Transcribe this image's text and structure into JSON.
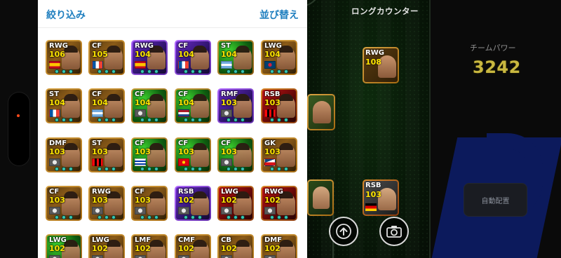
{
  "sheet": {
    "filter_label": "絞り込み",
    "sort_label": "並び替え"
  },
  "formation": {
    "title": "ロングカウンター",
    "on_pitch": [
      {
        "position": "RWG",
        "rating": "108"
      },
      {
        "position": "RSB",
        "rating": "103"
      }
    ]
  },
  "panel": {
    "team_power_label": "チームパワー",
    "team_power_value": "3242",
    "auto_button_label": "自動配置"
  },
  "icons": {
    "upload": "upload-arrow-icon",
    "camera": "camera-icon"
  },
  "cards": [
    {
      "position": "RWG",
      "rating": "106",
      "tier": "gold",
      "flag": "spain"
    },
    {
      "position": "CF",
      "rating": "105",
      "tier": "gold",
      "flag": "france"
    },
    {
      "position": "RWG",
      "rating": "104",
      "tier": "purple",
      "flag": "spain"
    },
    {
      "position": "CF",
      "rating": "104",
      "tier": "purple",
      "flag": "france"
    },
    {
      "position": "ST",
      "rating": "104",
      "tier": "green",
      "flag": "argentina"
    },
    {
      "position": "LWG",
      "rating": "104",
      "tier": "gold",
      "flag": "psg"
    },
    {
      "position": "ST",
      "rating": "104",
      "tier": "gold",
      "flag": "france"
    },
    {
      "position": "CF",
      "rating": "104",
      "tier": "gold",
      "flag": "argentina"
    },
    {
      "position": "CF",
      "rating": "104",
      "tier": "green",
      "flag": "club"
    },
    {
      "position": "CF",
      "rating": "104",
      "tier": "green",
      "flag": "netherlands"
    },
    {
      "position": "RMF",
      "rating": "103",
      "tier": "purple",
      "flag": "club"
    },
    {
      "position": "RSB",
      "rating": "103",
      "tier": "red",
      "flag": "acmilan"
    },
    {
      "position": "DMF",
      "rating": "103",
      "tier": "gold",
      "flag": "club"
    },
    {
      "position": "ST",
      "rating": "103",
      "tier": "gold",
      "flag": "acmilan"
    },
    {
      "position": "CF",
      "rating": "103",
      "tier": "green",
      "flag": "uruguay"
    },
    {
      "position": "CF",
      "rating": "103",
      "tier": "green",
      "flag": "manutd"
    },
    {
      "position": "CF",
      "rating": "103",
      "tier": "green",
      "flag": "club"
    },
    {
      "position": "GK",
      "rating": "103",
      "tier": "gold",
      "flag": "czech"
    },
    {
      "position": "CF",
      "rating": "103",
      "tier": "gold",
      "flag": "club"
    },
    {
      "position": "RWG",
      "rating": "103",
      "tier": "gold",
      "flag": "club"
    },
    {
      "position": "CF",
      "rating": "103",
      "tier": "gold",
      "flag": "club"
    },
    {
      "position": "RSB",
      "rating": "102",
      "tier": "purple",
      "flag": "club"
    },
    {
      "position": "LWG",
      "rating": "102",
      "tier": "red",
      "flag": "club"
    },
    {
      "position": "RWG",
      "rating": "102",
      "tier": "red",
      "flag": "club"
    },
    {
      "position": "LWG",
      "rating": "102",
      "tier": "green",
      "flag": "club"
    },
    {
      "position": "LWG",
      "rating": "102",
      "tier": "gold",
      "flag": "club"
    },
    {
      "position": "LMF",
      "rating": "102",
      "tier": "gold",
      "flag": "club"
    },
    {
      "position": "CMF",
      "rating": "102",
      "tier": "gold",
      "flag": "club"
    },
    {
      "position": "CB",
      "rating": "102",
      "tier": "gold",
      "flag": "club"
    },
    {
      "position": "DMF",
      "rating": "102",
      "tier": "gold",
      "flag": "club"
    }
  ],
  "colors": {
    "link_blue": "#1f7fbf",
    "rating_yellow": "#ffe600",
    "team_power_gold": "#c9b840",
    "panel_blue": "#0c1a5c"
  }
}
